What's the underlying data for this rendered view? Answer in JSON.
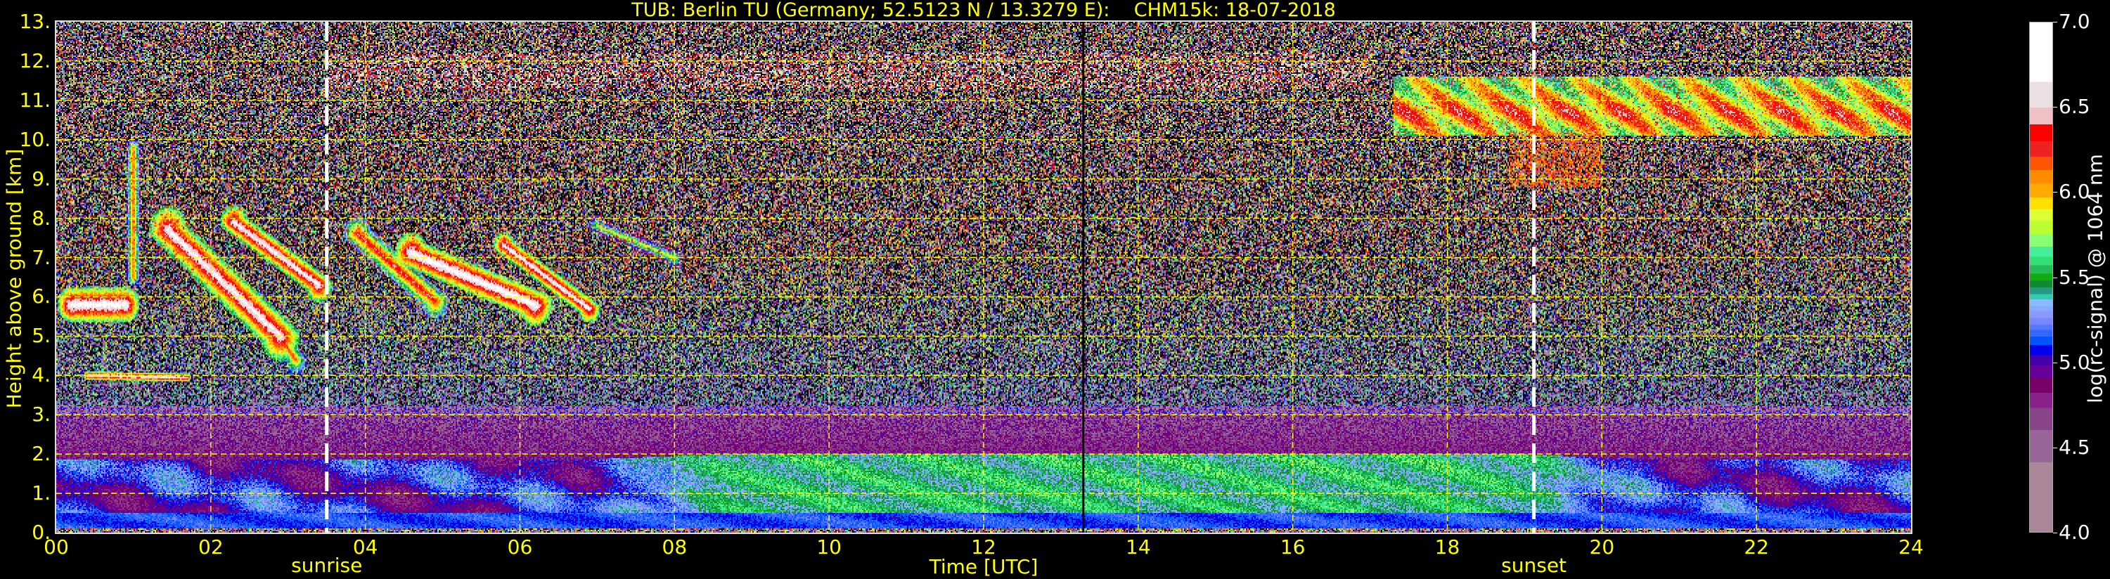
{
  "chart_data": {
    "type": "heatmap",
    "title": "TUB: Berlin TU (Germany; 52.5123 N / 13.3279 E):    CHM15k: 18-07-2018",
    "xlabel": "Time [UTC]",
    "ylabel": "Height above ground [km]",
    "xlim": [
      0,
      24
    ],
    "ylim": [
      0,
      13
    ],
    "x_ticks": [
      "00",
      "02",
      "04",
      "06",
      "08",
      "10",
      "12",
      "14",
      "16",
      "18",
      "20",
      "22",
      "24"
    ],
    "y_ticks": [
      "0.",
      "1.",
      "2.",
      "3.",
      "4.",
      "5.",
      "6.",
      "7.",
      "8.",
      "9.",
      "10.",
      "11.",
      "12.",
      "13."
    ],
    "grid": true,
    "grid_color": "#ffff00",
    "annotations": [
      {
        "label": "sunrise",
        "x": 3.5
      },
      {
        "label": "sunset",
        "x": 19.12
      }
    ],
    "marker_line_x": 13.29,
    "colorbar": {
      "label": "log(rc-signal) @ 1064 nm",
      "range": [
        4.0,
        7.0
      ],
      "ticks": [
        "4.0",
        "4.5",
        "5.0",
        "5.5",
        "6.0",
        "6.5",
        "7.0"
      ],
      "under_color": "#000000",
      "bands": [
        {
          "from": 4.0,
          "to": 4.41,
          "color": "#aa8899"
        },
        {
          "from": 4.41,
          "to": 4.6,
          "color": "#996699"
        },
        {
          "from": 4.6,
          "to": 4.73,
          "color": "#884488"
        },
        {
          "from": 4.73,
          "to": 4.82,
          "color": "#882288"
        },
        {
          "from": 4.82,
          "to": 4.91,
          "color": "#770066"
        },
        {
          "from": 4.91,
          "to": 4.98,
          "color": "#660099"
        },
        {
          "from": 4.98,
          "to": 5.04,
          "color": "#4400aa"
        },
        {
          "from": 5.04,
          "to": 5.1,
          "color": "#0000ee"
        },
        {
          "from": 5.1,
          "to": 5.15,
          "color": "#0055ff"
        },
        {
          "from": 5.15,
          "to": 5.19,
          "color": "#3366ff"
        },
        {
          "from": 5.19,
          "to": 5.22,
          "color": "#5577ff"
        },
        {
          "from": 5.22,
          "to": 5.26,
          "color": "#7788ff"
        },
        {
          "from": 5.26,
          "to": 5.3,
          "color": "#8899ff"
        },
        {
          "from": 5.3,
          "to": 5.33,
          "color": "#88aaff"
        },
        {
          "from": 5.33,
          "to": 5.37,
          "color": "#88bbff"
        },
        {
          "from": 5.37,
          "to": 5.4,
          "color": "#33ccaa"
        },
        {
          "from": 5.4,
          "to": 5.44,
          "color": "#229988"
        },
        {
          "from": 5.44,
          "to": 5.48,
          "color": "#118833"
        },
        {
          "from": 5.48,
          "to": 5.52,
          "color": "#11aa11"
        },
        {
          "from": 5.52,
          "to": 5.57,
          "color": "#22bb55"
        },
        {
          "from": 5.57,
          "to": 5.62,
          "color": "#33dd77"
        },
        {
          "from": 5.62,
          "to": 5.68,
          "color": "#44ee99"
        },
        {
          "from": 5.68,
          "to": 5.75,
          "color": "#88ff77"
        },
        {
          "from": 5.75,
          "to": 5.83,
          "color": "#bbff33"
        },
        {
          "from": 5.83,
          "to": 5.9,
          "color": "#ddff33"
        },
        {
          "from": 5.9,
          "to": 5.97,
          "color": "#ffe000"
        },
        {
          "from": 5.97,
          "to": 6.05,
          "color": "#ffaa00"
        },
        {
          "from": 6.05,
          "to": 6.13,
          "color": "#ff8c00"
        },
        {
          "from": 6.13,
          "to": 6.21,
          "color": "#ff5500"
        },
        {
          "from": 6.21,
          "to": 6.3,
          "color": "#ee2222"
        },
        {
          "from": 6.3,
          "to": 6.4,
          "color": "#ff0000"
        },
        {
          "from": 6.4,
          "to": 6.5,
          "color": "#f0c0c4"
        },
        {
          "from": 6.5,
          "to": 6.65,
          "color": "#ece0e2"
        },
        {
          "from": 6.65,
          "to": 7.0,
          "color": "#ffffff"
        }
      ]
    }
  }
}
